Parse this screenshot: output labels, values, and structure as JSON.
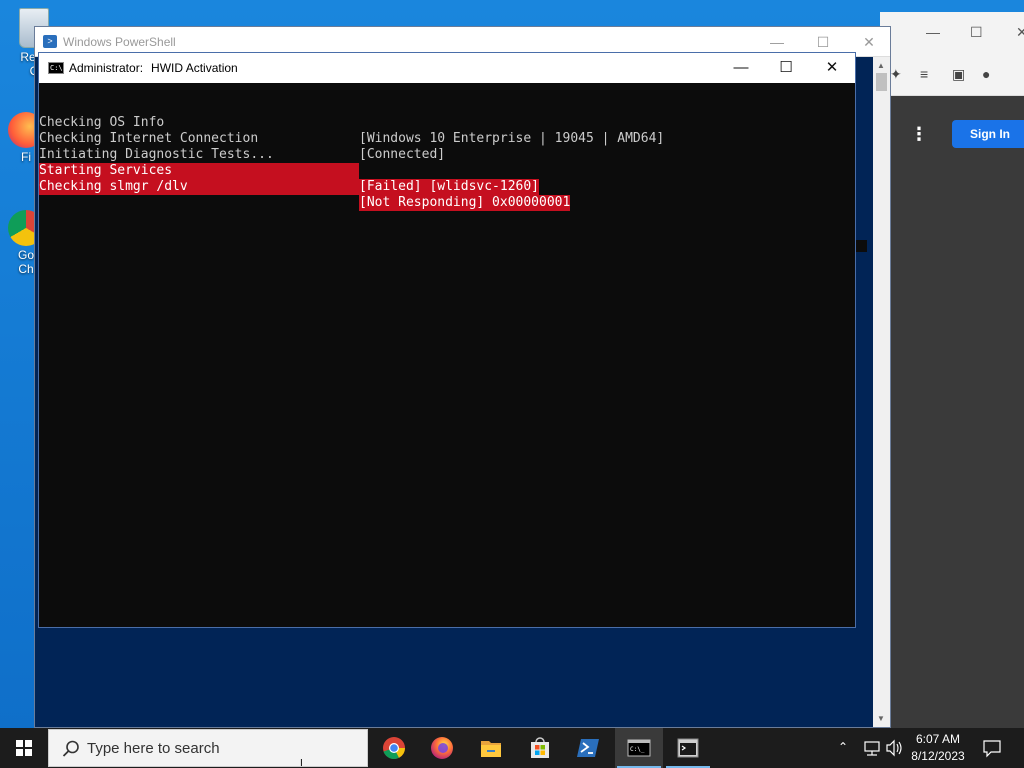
{
  "desktop": {
    "icons": [
      {
        "label": "Recy",
        "sub": "C"
      },
      {
        "label": "Fi"
      },
      {
        "label": "Go",
        "sub": "Ch"
      }
    ]
  },
  "browser": {
    "signin_label": "Sign In"
  },
  "powershell": {
    "title": "Windows PowerShell"
  },
  "cmd": {
    "title_prefix": "Administrator:",
    "title_name": "HWID Activation",
    "lines": [
      {
        "left": "Checking OS Info",
        "right": "[Windows 10 Enterprise | 19045 | AMD64]",
        "status": "normal"
      },
      {
        "left": "Checking Internet Connection",
        "right": "[Connected]",
        "status": "normal"
      },
      {
        "left": "Initiating Diagnostic Tests...",
        "right": "",
        "status": "normal"
      },
      {
        "left": "Starting Services",
        "right": "[Failed] [wlidsvc-1260]",
        "status": "error"
      },
      {
        "left": "Checking slmgr /dlv",
        "right": "[Not Responding] 0x00000001",
        "status": "error"
      }
    ]
  },
  "taskbar": {
    "search_placeholder": "Type here to search",
    "apps": [
      "chrome-icon",
      "firefox-icon",
      "file-explorer-icon",
      "store-icon",
      "powershell-icon",
      "cmd-icon",
      "admin-cmd-icon"
    ],
    "clock_time": "6:07 AM",
    "clock_date": "8/12/2023"
  },
  "colors": {
    "error_bg": "#c50f1f",
    "console_bg": "#0c0c0c",
    "powershell_bg": "#012456",
    "accent": "#1a73e8"
  }
}
